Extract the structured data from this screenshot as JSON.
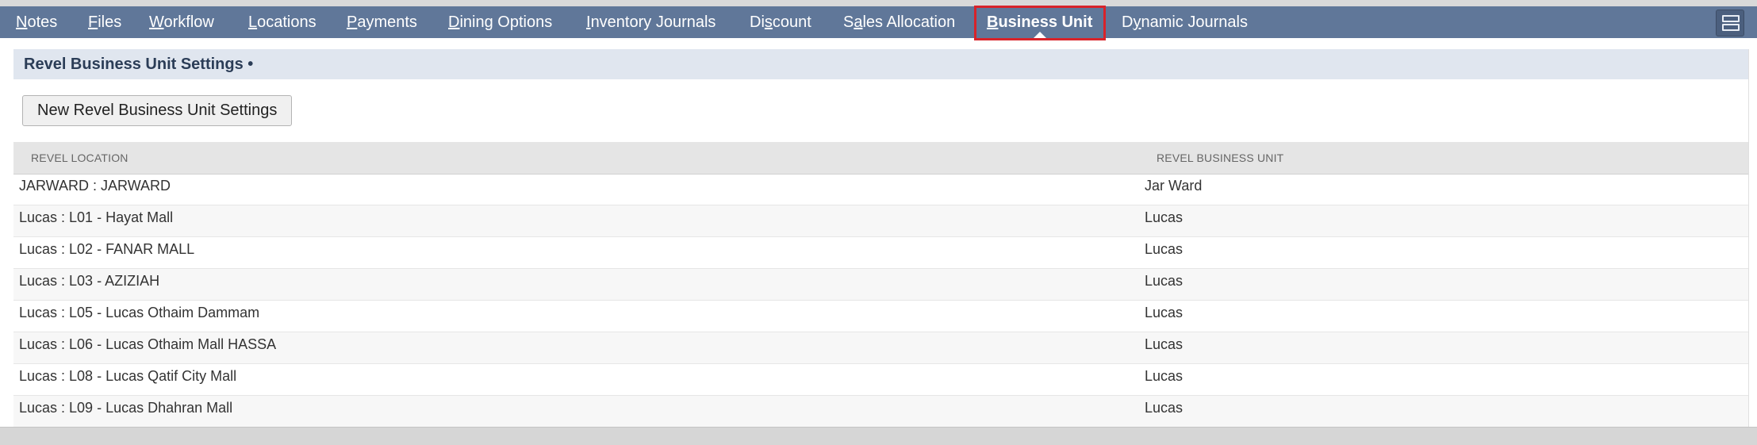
{
  "tabs": [
    {
      "first": "N",
      "rest": "otes"
    },
    {
      "first": "F",
      "rest": "iles"
    },
    {
      "first": "W",
      "rest": "orkflow"
    },
    {
      "first": "L",
      "rest": "ocations"
    },
    {
      "first": "P",
      "rest": "ayments"
    },
    {
      "first": "D",
      "rest": "ining Options"
    },
    {
      "first": "I",
      "rest": "nventory Journals"
    },
    {
      "pre": "Di",
      "first": "s",
      "rest": "count"
    },
    {
      "pre": "S",
      "first": "a",
      "rest": "les Allocation"
    },
    {
      "first": "B",
      "rest": "usiness Unit"
    },
    {
      "pre": "D",
      "first": "y",
      "rest": "namic Journals"
    }
  ],
  "active_tab": "Business Unit",
  "section": {
    "title": "Revel Business Unit Settings •"
  },
  "new_button_label": "New Revel Business Unit Settings",
  "table": {
    "columns": [
      "REVEL LOCATION",
      "REVEL BUSINESS UNIT"
    ],
    "rows": [
      {
        "location": "JARWARD : JARWARD",
        "business_unit": "Jar Ward"
      },
      {
        "location": "Lucas : L01 - Hayat Mall",
        "business_unit": "Lucas"
      },
      {
        "location": "Lucas : L02 - FANAR MALL",
        "business_unit": "Lucas"
      },
      {
        "location": "Lucas : L03 - AZIZIAH",
        "business_unit": "Lucas"
      },
      {
        "location": "Lucas : L05 - Lucas Othaim Dammam",
        "business_unit": "Lucas"
      },
      {
        "location": "Lucas : L06 - Lucas Othaim Mall HASSA",
        "business_unit": "Lucas"
      },
      {
        "location": "Lucas : L08 - Lucas Qatif City Mall",
        "business_unit": "Lucas"
      },
      {
        "location": "Lucas : L09 - Lucas Dhahran Mall",
        "business_unit": "Lucas"
      }
    ]
  },
  "colors": {
    "tabbar": "#607799",
    "highlight": "#d8232a",
    "section_header": "#e0e6ef"
  }
}
